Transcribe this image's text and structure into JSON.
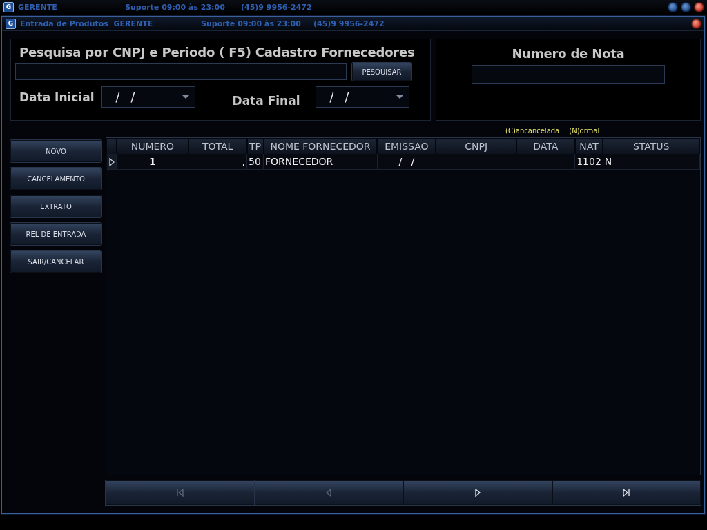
{
  "app_bar": {
    "logo": "G",
    "title": "GERENTE",
    "support": "Suporte 09:00 às 23:00",
    "phone": "(45)9 9956-2472"
  },
  "window": {
    "logo": "G",
    "title": "Entrada de Produtos  GERENTE",
    "support": "Suporte 09:00 às 23:00",
    "phone": "(45)9 9956-2472"
  },
  "search_panel": {
    "title": "Pesquisa por CNPJ e Periodo ( F5) Cadastro Fornecedores",
    "search_button": "PESQUISAR",
    "start_date": {
      "label": "Data Inicial",
      "value": "/   /"
    },
    "end_date": {
      "label": "Data Final",
      "value": "/   /"
    }
  },
  "note_panel": {
    "title": "Numero de Nota"
  },
  "legend": [
    "(C)ancancelada",
    "(N)ormal"
  ],
  "side_buttons": [
    "NOVO",
    "CANCELAMENTO",
    "EXTRATO",
    "REL DE ENTRADA",
    "SAIR/CANCELAR"
  ],
  "table": {
    "columns": [
      "NUMERO",
      "TOTAL",
      "TP",
      "NOME FORNECEDOR",
      "EMISSAO",
      "CNPJ",
      "DATA",
      "NAT",
      "STATUS"
    ],
    "rows": [
      {
        "selected": true,
        "cells": [
          "1",
          ",",
          "50",
          "FORNECEDOR",
          "/   /",
          null,
          null,
          "1102",
          "N"
        ]
      }
    ]
  },
  "navigator": [
    {
      "kind": "first",
      "disabled": true
    },
    {
      "kind": "prior",
      "disabled": true
    },
    {
      "kind": "next",
      "disabled": false
    },
    {
      "kind": "last",
      "disabled": false
    }
  ]
}
